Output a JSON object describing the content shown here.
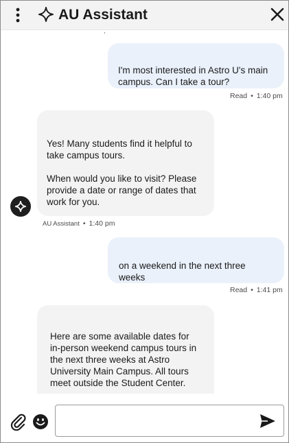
{
  "header": {
    "title": "AU Assistant",
    "icons": {
      "menu": "kebab-vertical-icon",
      "logo": "sparkle-icon",
      "close": "close-x-icon"
    }
  },
  "messages": [
    {
      "sender": "user",
      "text": "I'm most interested in Astro U's main campus. Can I take a tour?",
      "status": "Read",
      "time": "1:40 pm"
    },
    {
      "sender": "bot",
      "text": "Yes! Many students find it helpful to take campus tours.\n\nWhen would you like to visit? Please provide a date or range of dates that work for you.",
      "name": "AU Assistant",
      "time": "1:40 pm"
    },
    {
      "sender": "user",
      "text": "on a weekend in the next three weeks",
      "status": "Read",
      "time": "1:41 pm"
    },
    {
      "sender": "bot",
      "text": "Here are some available dates for in-person weekend campus tours in the next three weeks at Astro University Main Campus. All tours meet outside the Student Center."
    }
  ],
  "composer": {
    "value": "",
    "icons": {
      "attach": "paperclip-icon",
      "emoji": "emoji-icon",
      "send": "send-icon"
    }
  },
  "colors": {
    "header_bg": "#f3f3f3",
    "user_bubble": "#eaf1fb",
    "bot_bubble": "#f3f3f3",
    "avatar_bg": "#1f1f1f"
  }
}
